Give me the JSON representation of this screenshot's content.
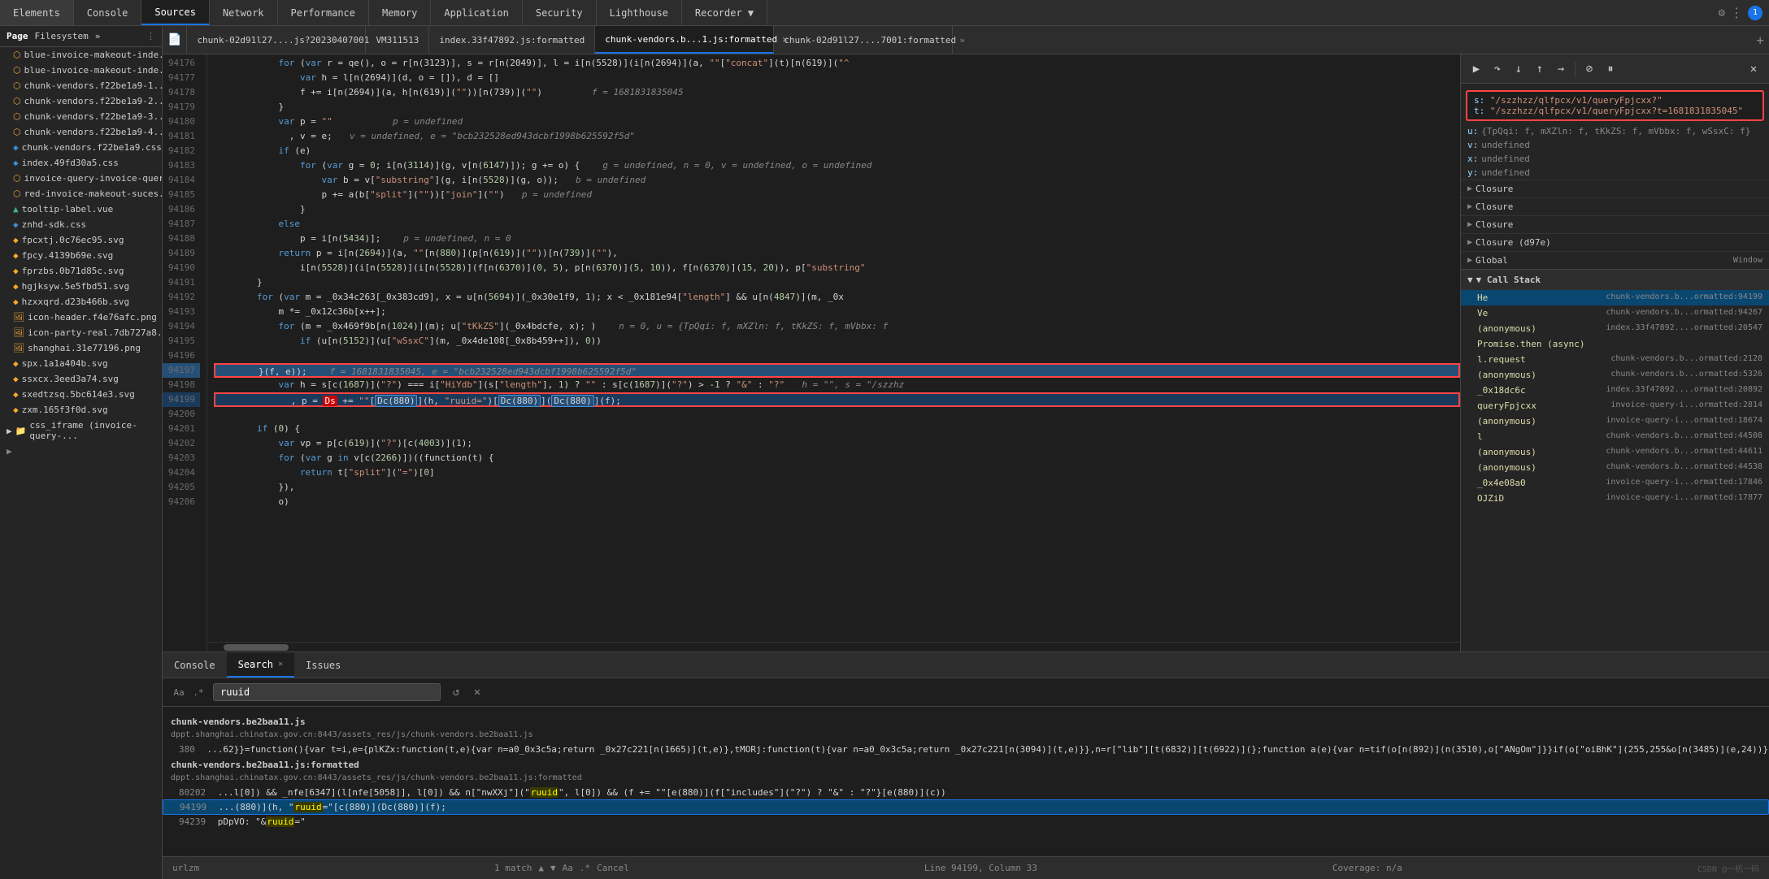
{
  "topTabs": {
    "items": [
      {
        "label": "Elements",
        "active": false
      },
      {
        "label": "Console",
        "active": false
      },
      {
        "label": "Sources",
        "active": true
      },
      {
        "label": "Network",
        "active": false
      },
      {
        "label": "Performance",
        "active": false
      },
      {
        "label": "Memory",
        "active": false
      },
      {
        "label": "Application",
        "active": false
      },
      {
        "label": "Security",
        "active": false
      },
      {
        "label": "Lighthouse",
        "active": false
      },
      {
        "label": "Recorder ▼",
        "active": false
      }
    ]
  },
  "sidebar": {
    "headers": [
      "Page",
      "Filesystem",
      "»"
    ],
    "items": [
      {
        "label": "blue-invoice-makeout-inde...",
        "icon": "js"
      },
      {
        "label": "blue-invoice-makeout-inde...",
        "icon": "js"
      },
      {
        "label": "chunk-vendors.f22be1a9-1...",
        "icon": "js"
      },
      {
        "label": "chunk-vendors.f22be1a9-2...",
        "icon": "js"
      },
      {
        "label": "chunk-vendors.f22be1a9-3...",
        "icon": "js"
      },
      {
        "label": "chunk-vendors.f22be1a9-4...",
        "icon": "js"
      },
      {
        "label": "chunk-vendors.f22be1a9.css",
        "icon": "css"
      },
      {
        "label": "index.49fd30a5.css",
        "icon": "css"
      },
      {
        "label": "invoice-query-invoice-quer...",
        "icon": "js"
      },
      {
        "label": "red-invoice-makeout-suces...",
        "icon": "js"
      },
      {
        "label": "tooltip-label.vue",
        "icon": "vue"
      },
      {
        "label": "znhd-sdk.css",
        "icon": "css"
      },
      {
        "label": "fpcxtj.0c76ec95.svg",
        "icon": "svg"
      },
      {
        "label": "fpcy.4139b69e.svg",
        "icon": "svg"
      },
      {
        "label": "fprzbs.0b71d85c.svg",
        "icon": "svg"
      },
      {
        "label": "hgjksyw.5e5fbd51.svg",
        "icon": "svg"
      },
      {
        "label": "hzxxqrd.d23b466b.svg",
        "icon": "svg"
      },
      {
        "label": "icon-header.f4e76afc.png",
        "icon": "img"
      },
      {
        "label": "icon-party-real.7db727a8.p...",
        "icon": "img"
      },
      {
        "label": "shanghai.31e77196.png",
        "icon": "img"
      },
      {
        "label": "spx.1a1a404b.svg",
        "icon": "svg"
      },
      {
        "label": "ssxcx.3eed3a74.svg",
        "icon": "svg"
      },
      {
        "label": "sxedtzsq.5bc614e3.svg",
        "icon": "svg"
      },
      {
        "label": "zxm.165f3f0d.svg",
        "icon": "svg"
      },
      {
        "label": "▶ css_iframe (invoice-query-...",
        "icon": "folder"
      }
    ]
  },
  "fileTabs": [
    {
      "label": "chunk-02d91l27....js?20230407001",
      "active": false,
      "closeable": false
    },
    {
      "label": "VM311513",
      "active": false,
      "closeable": false
    },
    {
      "label": "index.33f47892.js:formatted",
      "active": false,
      "closeable": false
    },
    {
      "label": "chunk-vendors.b...1.js:formatted",
      "active": false,
      "closeable": true
    },
    {
      "label": "chunk-02d91l27....7001:formatted",
      "active": false,
      "closeable": false
    }
  ],
  "codeLines": [
    {
      "num": 94176,
      "code": "            for (var r = qe(), o = r[n(3123)], s = r[n(2049)], l = i[n(5528)](i[n(2694)](a, \"\"[\"concat\"](t)[n(619)](\"^",
      "highlight": false
    },
    {
      "num": 94177,
      "code": "                var h = l[n(2694)](d, o = []), d = []",
      "highlight": false
    },
    {
      "num": 94178,
      "code": "                f += i[n(2694)](a, h[n(619)](\"\")}[n(739)](\"\")        f = 1681831835045",
      "highlight": false
    },
    {
      "num": 94179,
      "code": "            }",
      "highlight": false
    },
    {
      "num": 94180,
      "code": "            var p = \"\"          p = undefined",
      "highlight": false
    },
    {
      "num": 94181,
      "code": "              , v = e;  v = undefined, e = \"bcb232528ed943dcbf1998b625592f5d\"",
      "highlight": false
    },
    {
      "num": 94182,
      "code": "            if (e)",
      "highlight": false
    },
    {
      "num": 94183,
      "code": "                for (var g = 0; i[n(3114)](g, v[n(6147)]); g += o) {   g = undefined, n = 0, v = undefined, o = undefined",
      "highlight": false
    },
    {
      "num": 94184,
      "code": "                    var b = v[\"substring\"](g, i[n(5528)](g, o));  b = undefined",
      "highlight": false
    },
    {
      "num": 94185,
      "code": "                    p += a(b[\"split\"](\"\")}[\"join\"](\"\")  p = undefined",
      "highlight": false
    },
    {
      "num": 94186,
      "code": "                }",
      "highlight": false
    },
    {
      "num": 94187,
      "code": "            else",
      "highlight": false
    },
    {
      "num": 94188,
      "code": "                p = i[n(5434)];   p = undefined, n = 0",
      "highlight": false
    },
    {
      "num": 94189,
      "code": "            return p = i[n(2694)](a, \"\"[n(880)](p[n(619)](\"\")}[n(739)](\"\"),",
      "highlight": false
    },
    {
      "num": 94190,
      "code": "                i[n(5528)](i[n(5528)](i[n(5528)](f[n(6370)](0, 5), p[n(6370)](5, 10)), f[n(6370)](15, 20)), p[\"substring\"",
      "highlight": false
    },
    {
      "num": 94191,
      "code": "        }",
      "highlight": false
    },
    {
      "num": 94192,
      "code": "        for (var m = _0x34c263[_0x383cd9], x = u[n(5694)](_0x30e1f9, 1); x < _0x181e94[\"length\"] && u[n(4847)](m, _0x",
      "highlight": false
    },
    {
      "num": 94193,
      "code": "            m *= _0x12c36b[x++];",
      "highlight": false
    },
    {
      "num": 94194,
      "code": "            for (m = _0x469f9b[n(1024)](m); u[\"tKkZS\"](_0x4bdcfe, x); )   n = 0, u = {TpQqi: f, mXZln: f, tKkZS: f, mVbbx: f",
      "highlight": false
    },
    {
      "num": 94195,
      "code": "                if (u[n(5152)](u[\"wSsxC\"](m, _0x4de108[_0x8b459++]), 0))",
      "highlight": false
    },
    {
      "num": 94196,
      "code": "",
      "highlight": false
    },
    {
      "num": 94197,
      "code": "        }(f, e));   f = 1681831835045, e = \"bcb232528ed943dcbf1998b625592f5d\"",
      "highlight": true,
      "boxed": true
    },
    {
      "num": 94198,
      "code": "            var h = s[c(1687)](\"?\") === i[\"HiYdb\"](s[\"length\"], 1) ? \"\" : s[c(1687)](\"?\") > -1 ? \"&\" : \"?\"  h = \"\", s = \"/szzhz",
      "highlight": false
    },
    {
      "num": 94199,
      "code": "              , p = Ds += \"\"[Dc(880)](h, \"ruuid=\")[Dc(880)](Dc(880)](f);",
      "highlight": false,
      "active": true,
      "boxed": true
    },
    {
      "num": 94200,
      "code": "",
      "highlight": false
    },
    {
      "num": 94201,
      "code": "        if (0) {",
      "highlight": false
    },
    {
      "num": 94202,
      "code": "            var vp = p[c(619)](\"?\")[c(4003)](1);",
      "highlight": false
    },
    {
      "num": 94203,
      "code": "            for (var g in v[c(2266)])((function(t) {",
      "highlight": false
    },
    {
      "num": 94204,
      "code": "                return t[\"split\"](\"=\")[0]",
      "highlight": false
    },
    {
      "num": 94205,
      "code": "            }),",
      "highlight": false
    },
    {
      "num": 94206,
      "code": "            o)",
      "highlight": false
    }
  ],
  "urlBox": {
    "sLabel": "s:",
    "sVal": "\"/szzhzz/qlfpcx/v1/queryFpjcxx?\"",
    "tLabel": "t:",
    "tVal": "\"/szzhzz/qlfpcx/v1/queryFpjcxx?t=1681831835045\""
  },
  "scopeVars": [
    {
      "key": "u:",
      "val": "{TpQqi: f, mXZln: f, tKkZS: f, mVbbx: f, wSsxC: f}"
    },
    {
      "key": "v:",
      "val": "undefined"
    },
    {
      "key": "x:",
      "val": "undefined"
    },
    {
      "key": "y:",
      "val": "undefined"
    }
  ],
  "closures": [
    {
      "label": "▶ Closure"
    },
    {
      "label": "▶ Closure"
    },
    {
      "label": "▶ Closure"
    },
    {
      "label": "▶ Closure (d97e)"
    },
    {
      "label": "▶ Global",
      "right": "Window"
    }
  ],
  "callStack": {
    "header": "▼ Call Stack",
    "items": [
      {
        "fn": "He",
        "loc": "chunk-vendors.b...ormatted:94199",
        "active": true
      },
      {
        "fn": "Ve",
        "loc": "chunk-vendors.b...ormatted:94267"
      },
      {
        "fn": "(anonymous)",
        "loc": "index.33f47892....ormatted:20547"
      },
      {
        "fn": "Promise.then (async)",
        "loc": ""
      },
      {
        "fn": "l.request",
        "loc": "chunk-vendors.b...ormatted:2128"
      },
      {
        "fn": "(anonymous)",
        "loc": "chunk-vendors.b...ormatted:5326"
      },
      {
        "fn": "_0x18dc6c",
        "loc": "index.33f47892....ormatted:20892"
      },
      {
        "fn": "queryFpjcxx",
        "loc": "invoice-query-i...ormatted:2814"
      },
      {
        "fn": "(anonymous)",
        "loc": "invoice-query-i...ormatted:18674"
      },
      {
        "fn": "l",
        "loc": "chunk-vendors.b...ormatted:44508"
      },
      {
        "fn": "(anonymous)",
        "loc": "chunk-vendors.b...ormatted:44611"
      },
      {
        "fn": "(anonymous)",
        "loc": "chunk-vendors.b...ormatted:44538"
      },
      {
        "fn": "_0x4e08a0",
        "loc": "invoice-query-i...ormatted:17846"
      },
      {
        "fn": "OJZiD",
        "loc": "invoice-query-i...ormatted:17877"
      }
    ]
  },
  "statusBar": {
    "left": "urlzm",
    "match": "1 match",
    "position": "Line 94199, Column 33",
    "coverage": "Coverage: n/a"
  },
  "bottomTabs": [
    {
      "label": "Console",
      "active": false
    },
    {
      "label": "Search",
      "active": true,
      "closeable": true
    },
    {
      "label": "Issues",
      "active": false
    }
  ],
  "searchBar": {
    "label": "Aa",
    "dotLabel": ".*",
    "value": "ruuid",
    "placeholder": "Search"
  },
  "searchResults": [
    {
      "file": "chunk-vendors.be2baa11.js",
      "url": "dppt.shanghai.chinatax.gov.cn:8443/assets_res/js/chunk-vendors.be2baa11.js",
      "lines": [
        {
          "num": "380",
          "text": "...62}}=function(){var t=i,e=(plKZx:function(t,e){var n=a0_0x3c5a;return _0x27c221[n(1665)](t,e)},tMORj:function(t){var n=a0_0x3c5a;return _0x27c221[n(3094)](t,e)}},n=r[\"lib\"][t(6832)][t(6922)](};function a(e){var n=tif(o[n(892)](n(3510),o[\"ANgOm\"]}}if(o[\"oiBhK\"](255,255&o[n(3485)](e,24))}{var r=2...",
          "match": null
        }
      ]
    },
    {
      "file": "chunk-vendors.be2baa11.js:formatted",
      "url": "dppt.shanghai.chinatax.gov.cn:8443/assets_res/js/chunk-vendors.be2baa11.js:formatted",
      "lines": [
        {
          "num": "80202",
          "text": "...l[0]) && _nfe[6347](l[nfe[5058]], l[0]) && n[\"nwXXj\"](\"ruuid\", l[0]) && (f += \"\"[e(880)](f[\"includes\"](\"?\") ? \"&\" : \"?\"]}[e(880)](c)}",
          "match": "ruuid",
          "selected": false
        },
        {
          "num": "94199",
          "text": "...(880)](h, \"ruuid=\")[c(880)](Dc(880)](f);",
          "match": "ruuid",
          "selected": true
        }
      ]
    },
    {
      "file": "",
      "url": "",
      "lines": [
        {
          "num": "94239",
          "text": "pDpVO: \"&ruuid=\"",
          "match": "ruuid",
          "selected": false
        }
      ]
    }
  ],
  "debuggerBtns": [
    "resume",
    "step-over",
    "step-into",
    "step-out",
    "step",
    "deactivate",
    "pause-on-exceptions"
  ],
  "icons": {
    "resume": "▶",
    "step-over": "↷",
    "step-into": "↓",
    "step-out": "↑",
    "step": "→",
    "deactivate": "⊘",
    "pause": "⏸"
  }
}
